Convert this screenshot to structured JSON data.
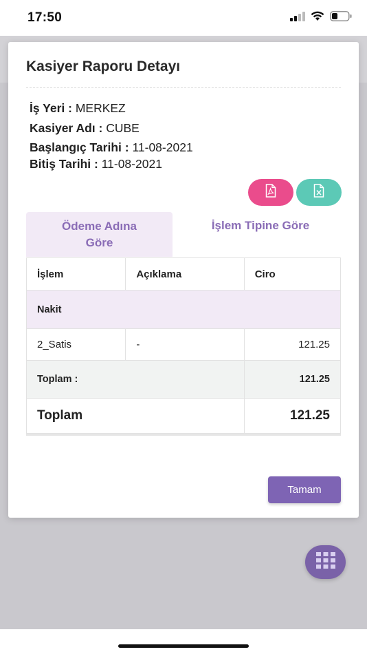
{
  "status_bar": {
    "time": "17:50"
  },
  "modal": {
    "title": "Kasiyer Raporu Detayı",
    "info": [
      {
        "label": "İş Yeri :",
        "value": "MERKEZ"
      },
      {
        "label": "Kasiyer Adı :",
        "value": "CUBE"
      },
      {
        "label": "Başlangıç Tarihi :",
        "value": "11-08-2021"
      },
      {
        "label": "Bitiş Tarihi :",
        "value": "11-08-2021"
      }
    ],
    "tabs": [
      {
        "label_line1": "Ödeme Adına",
        "label_line2": "Göre"
      },
      {
        "label": "İşlem Tipine Göre"
      }
    ],
    "table": {
      "headers": [
        "İşlem",
        "Açıklama",
        "Ciro"
      ],
      "group_label": "Nakit",
      "rows": [
        {
          "islem": "2_Satis",
          "aciklama": "-",
          "ciro": "121.25"
        }
      ],
      "subtotal": {
        "label": "Toplam :",
        "value": "121.25"
      },
      "total": {
        "label": "Toplam",
        "value": "121.25"
      }
    },
    "ok_button": "Tamam"
  },
  "colors": {
    "accent": "#7e64b4",
    "pdf_button": "#ea4c8c",
    "excel_button": "#5cc9b6",
    "tab_active_bg": "#f2eaf6"
  },
  "icons": {
    "pdf": "pdf-file-icon",
    "excel": "excel-file-icon",
    "menu": "grid-menu-icon"
  }
}
